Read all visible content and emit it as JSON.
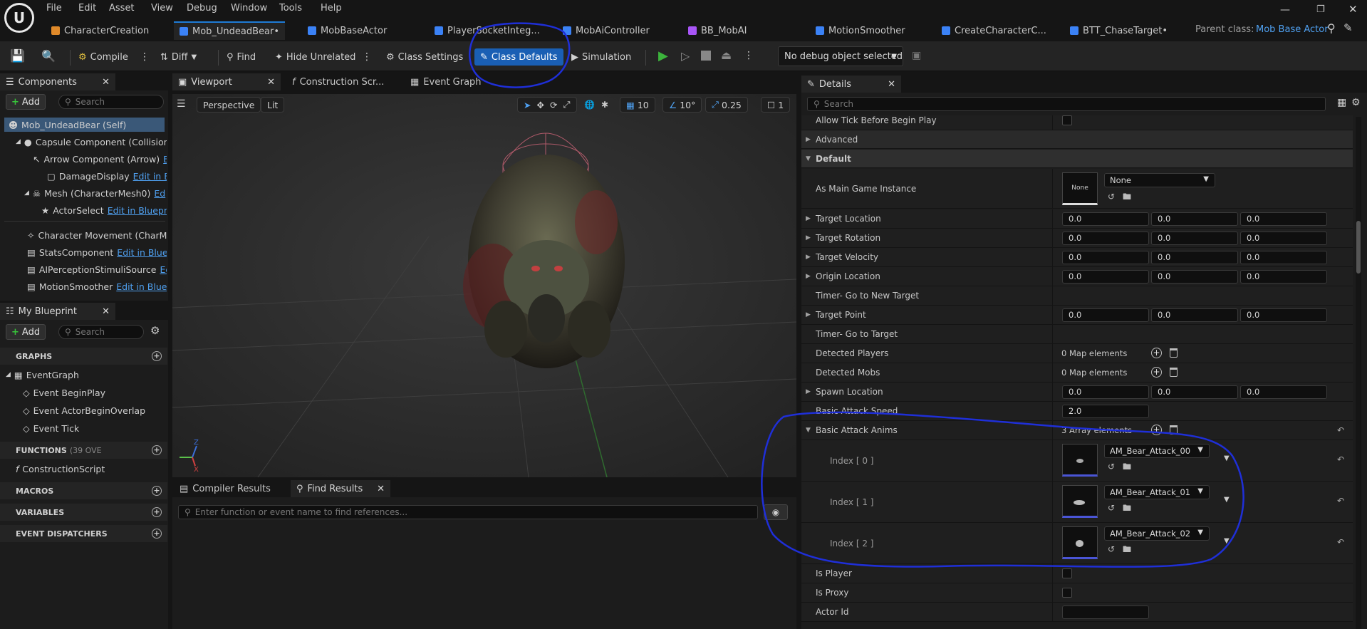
{
  "menu": [
    "File",
    "Edit",
    "Asset",
    "View",
    "Debug",
    "Window",
    "Tools",
    "Help"
  ],
  "tabs": [
    {
      "label": "CharacterCreation",
      "color": "#e08a2a"
    },
    {
      "label": "Mob_UndeadBear•",
      "color": "#3b82f6"
    },
    {
      "label": "MobBaseActor",
      "color": "#3b82f6"
    },
    {
      "label": "PlayerSocketInteg...",
      "color": "#3b82f6"
    },
    {
      "label": "MobAiController",
      "color": "#3b82f6"
    },
    {
      "label": "BB_MobAI",
      "color": "#a855f7"
    },
    {
      "label": "MotionSmoother",
      "color": "#3b82f6"
    },
    {
      "label": "CreateCharacterC...",
      "color": "#3b82f6"
    },
    {
      "label": "BTT_ChaseTarget•",
      "color": "#3b82f6"
    }
  ],
  "parent_class": {
    "label": "Parent class:",
    "value": "Mob Base Actor"
  },
  "toolbar": {
    "compile": "Compile",
    "diff": "Diff",
    "find": "Find",
    "hide_unrelated": "Hide Unrelated",
    "class_settings": "Class Settings",
    "class_defaults": "Class Defaults",
    "simulation": "Simulation",
    "debug_object": "No debug object selected"
  },
  "components_panel": {
    "title": "Components",
    "add": "Add",
    "search_placeholder": "Search",
    "items": [
      {
        "label": "Mob_UndeadBear (Self)",
        "link": ""
      },
      {
        "label": "Capsule Component (CollisionC",
        "link": ""
      },
      {
        "label": "Arrow Component (Arrow)",
        "link": "E"
      },
      {
        "label": "DamageDisplay",
        "link": "Edit in Blue"
      },
      {
        "label": "Mesh (CharacterMesh0)",
        "link": "Ed"
      },
      {
        "label": "ActorSelect",
        "link": "Edit in Bluepri"
      },
      {
        "label": "Character Movement (CharMo",
        "link": ""
      },
      {
        "label": "StatsComponent",
        "link": "Edit in Bluep"
      },
      {
        "label": "AIPerceptionStimuliSource",
        "link": "Ed"
      },
      {
        "label": "MotionSmoother",
        "link": "Edit in Bluep"
      }
    ]
  },
  "my_blueprint": {
    "title": "My Blueprint",
    "add": "Add",
    "search_placeholder": "Search",
    "graphs_label": "GRAPHS",
    "event_graph": "EventGraph",
    "events": [
      "Event BeginPlay",
      "Event ActorBeginOverlap",
      "Event Tick"
    ],
    "functions_label": "FUNCTIONS",
    "functions_count": "(39 OVE",
    "construction_script": "ConstructionScript",
    "macros_label": "MACROS",
    "variables_label": "VARIABLES",
    "dispatchers_label": "EVENT DISPATCHERS"
  },
  "editor_tabs": [
    "Viewport",
    "Construction Scr...",
    "Event Graph"
  ],
  "viewport": {
    "perspective": "Perspective",
    "lit": "Lit",
    "grid_size": "10",
    "rotation_snap": "10°",
    "scale_snap": "0.25",
    "camera_speed": "1"
  },
  "bottom_panel": {
    "tabs": [
      "Compiler Results",
      "Find Results"
    ],
    "search_placeholder": "Enter function or event name to find references..."
  },
  "details": {
    "title": "Details",
    "search_placeholder": "Search",
    "rows": {
      "allow_tick": "Allow Tick Before Begin Play",
      "advanced": "Advanced",
      "default": "Default",
      "main_game_instance": "As Main Game Instance",
      "mgi_value": "None",
      "mgi_thumb": "None",
      "target_location": "Target Location",
      "target_rotation": "Target Rotation",
      "target_velocity": "Target Velocity",
      "origin_location": "Origin Location",
      "timer_new_target": "Timer- Go to New Target",
      "target_point": "Target Point",
      "timer_target": "Timer- Go to Target",
      "detected_players": "Detected Players",
      "detected_players_value": "0 Map elements",
      "detected_mobs": "Detected Mobs",
      "detected_mobs_value": "0 Map elements",
      "spawn_location": "Spawn Location",
      "basic_attack_speed": "Basic Attack Speed",
      "basic_attack_speed_value": "2.0",
      "basic_attack_anims": "Basic Attack Anims",
      "basic_attack_anims_value": "3 Array elements",
      "is_player": "Is Player",
      "is_proxy": "Is Proxy",
      "actor_id": "Actor Id"
    },
    "zero": "0.0",
    "anims": [
      {
        "index": "Index [ 0 ]",
        "asset": "AM_Bear_Attack_00"
      },
      {
        "index": "Index [ 1 ]",
        "asset": "AM_Bear_Attack_01"
      },
      {
        "index": "Index [ 2 ]",
        "asset": "AM_Bear_Attack_02"
      }
    ]
  },
  "colors": {
    "accent": "#1a5fb4",
    "link": "#4fa0f0",
    "annotation": "#1f2fd8",
    "panel": "#1c1c1c"
  }
}
